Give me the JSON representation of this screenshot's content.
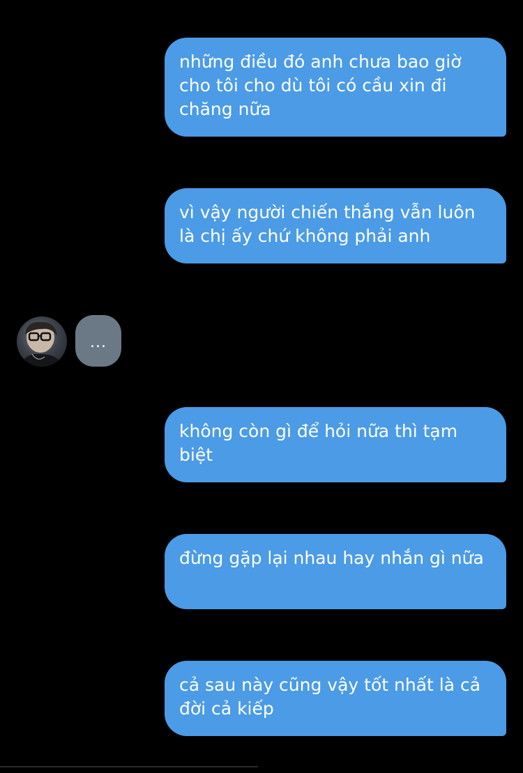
{
  "colors": {
    "background": "#000000",
    "outgoing_bubble": "#4b9be6",
    "typing_bubble": "#6b7885",
    "text": "#ffffff"
  },
  "messages": [
    {
      "text": "những điều đó anh chưa bao giờ cho tôi cho dù tôi có cầu xin đi chăng nữa"
    },
    {
      "text": "vì vậy người chiến thắng vẫn luôn là chị ấy chứ không phải anh"
    },
    {
      "text": "không còn gì để hỏi nữa thì tạm biệt"
    },
    {
      "text": "đừng gặp lại nhau hay nhắn gì nữa"
    },
    {
      "text": "cả sau này cũng vậy tốt nhất là cả đời cả kiếp"
    }
  ],
  "contact": {
    "avatar_icon": "user-avatar-photo",
    "typing_indicator": "..."
  }
}
